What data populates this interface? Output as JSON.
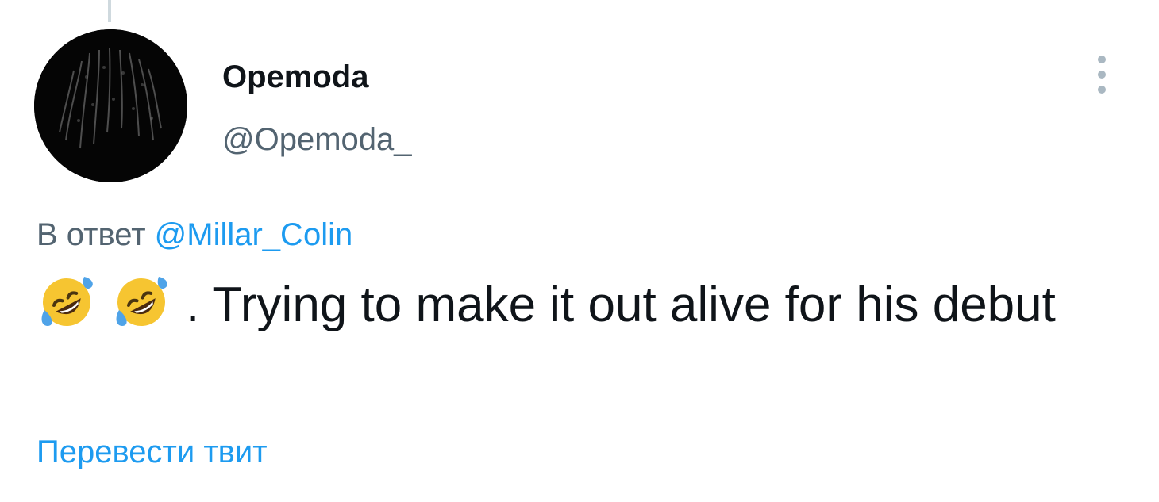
{
  "tweet": {
    "author": {
      "display_name": "Opemoda",
      "handle": "@Opemoda_",
      "avatar_icon": "profile-photo-dark"
    },
    "more_icon": "vertical-ellipsis-icon",
    "reply_prefix": "В ответ",
    "reply_to": "@Millar_Colin",
    "emojis": [
      "rolling-on-floor-laughing",
      "rolling-on-floor-laughing"
    ],
    "text": ". Trying to make it out alive for his debut",
    "translate_label": "Перевести твит"
  },
  "colors": {
    "text": "#0f1419",
    "secondary": "#536471",
    "link": "#1d9bf0",
    "thread_line": "#cfd9de",
    "more_dots": "#aab8c2"
  }
}
